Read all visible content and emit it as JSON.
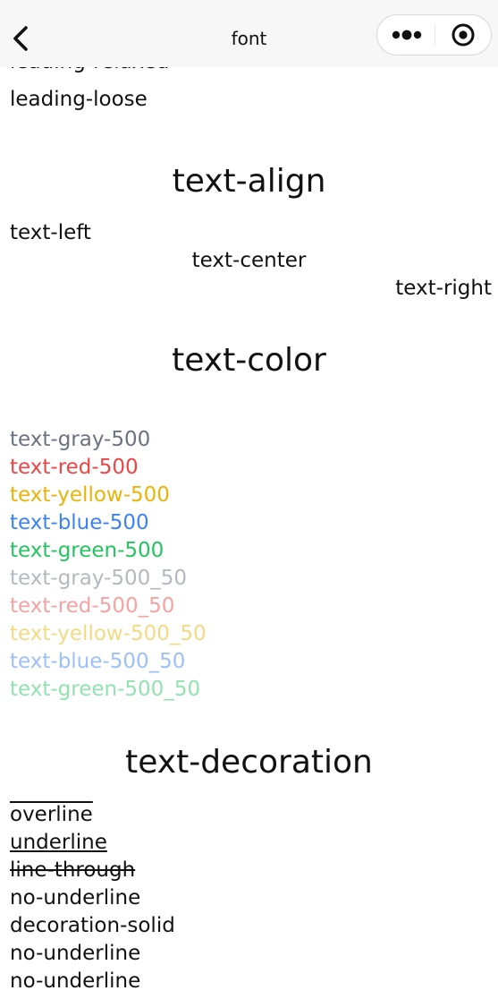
{
  "navbar": {
    "title": "font",
    "back_icon": "chevron-left-icon",
    "more_icon": "more-dots-icon",
    "close_icon": "target-circle-icon"
  },
  "leading": {
    "partial_item": "leading-relaxed",
    "loose_item": "leading-loose"
  },
  "text_align": {
    "title": "text-align",
    "left": "text-left",
    "center": "text-center",
    "right": "text-right"
  },
  "text_color": {
    "title": "text-color",
    "items": [
      {
        "label": "text-gray-500",
        "color": "#6b7280"
      },
      {
        "label": "text-red-500",
        "color": "#ef4444"
      },
      {
        "label": "text-yellow-500",
        "color": "#eab308"
      },
      {
        "label": "text-blue-500",
        "color": "#3b82f6"
      },
      {
        "label": "text-green-500",
        "color": "#22c55e"
      },
      {
        "label": "text-gray-500_50",
        "color": "#6b7280",
        "opacity": 0.5
      },
      {
        "label": "text-red-500_50",
        "color": "#ef4444",
        "opacity": 0.5
      },
      {
        "label": "text-yellow-500_50",
        "color": "#eab308",
        "opacity": 0.5
      },
      {
        "label": "text-blue-500_50",
        "color": "#3b82f6",
        "opacity": 0.5
      },
      {
        "label": "text-green-500_50",
        "color": "#22c55e",
        "opacity": 0.5
      }
    ]
  },
  "text_decoration": {
    "title": "text-decoration",
    "items": [
      {
        "label": "overline",
        "decoration": "overline"
      },
      {
        "label": "underline",
        "decoration": "underline"
      },
      {
        "label": "line-through",
        "decoration": "line-through"
      },
      {
        "label": "no-underline",
        "decoration": "none"
      },
      {
        "label": "decoration-solid",
        "decoration": "none"
      },
      {
        "label": "no-underline",
        "decoration": "none"
      },
      {
        "label": "no-underline",
        "decoration": "none"
      }
    ]
  }
}
